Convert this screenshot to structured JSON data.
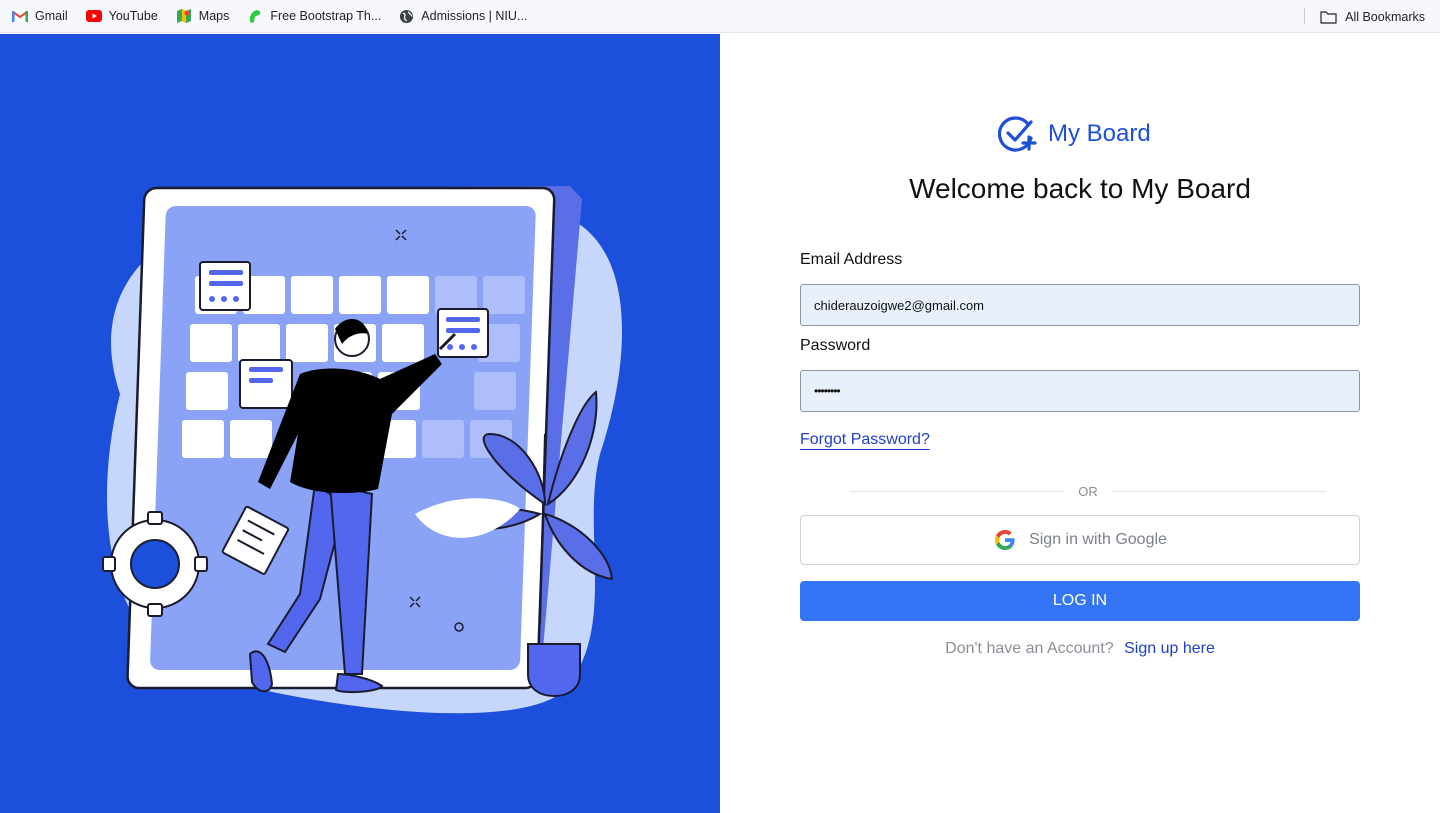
{
  "bookmarks": {
    "items": [
      {
        "label": "Gmail",
        "icon": "gmail-icon"
      },
      {
        "label": "YouTube",
        "icon": "youtube-icon"
      },
      {
        "label": "Maps",
        "icon": "maps-icon"
      },
      {
        "label": "Free Bootstrap Th...",
        "icon": "bootstrap-theme-icon"
      },
      {
        "label": "Admissions | NIU...",
        "icon": "globe-icon"
      }
    ],
    "all_bookmarks": "All Bookmarks"
  },
  "brand": {
    "name": "My Board",
    "icon": "check-plus-icon",
    "color": "#1f4fd6"
  },
  "form": {
    "title": "Welcome back to My Board",
    "email_label": "Email Address",
    "email_value": "chiderauzoigwe2@gmail.com",
    "password_label": "Password",
    "password_value": "••••••••",
    "forgot_link": "Forgot Password?",
    "or_text": "OR",
    "google_button": "Sign in with Google",
    "login_button": "LOG IN",
    "signup_prompt": "Don't have an Account?",
    "signup_link": "Sign up here"
  },
  "colors": {
    "panel_blue": "#1c4fdb",
    "button_blue": "#3475f5",
    "link_blue": "#1f3fc4",
    "input_bg": "#e8f0fe"
  }
}
